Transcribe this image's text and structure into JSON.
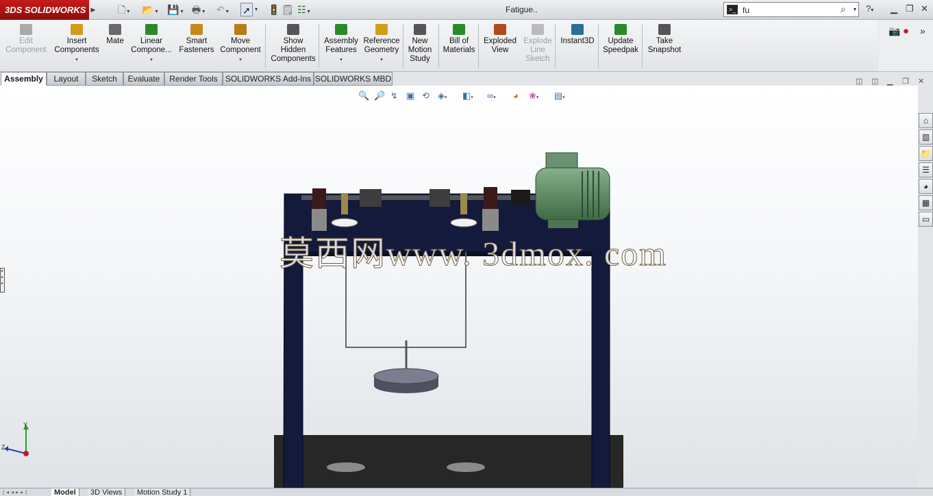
{
  "app": {
    "logo_text": "SOLIDWORKS",
    "logo_mark": "3DS",
    "document_title": "Fatigue.."
  },
  "search": {
    "value": "fu"
  },
  "help_icon": "?",
  "ribbon": {
    "buttons": [
      {
        "label": "Edit\nComponent",
        "icon": "edit-component-icon",
        "disabled": true
      },
      {
        "label": "Insert\nComponents",
        "icon": "insert-components-icon"
      },
      {
        "label": "Mate",
        "icon": "mate-icon"
      },
      {
        "label": "Linear\nCompone...",
        "icon": "linear-pattern-icon"
      },
      {
        "label": "Smart\nFasteners",
        "icon": "smart-fasteners-icon"
      },
      {
        "label": "Move\nComponent",
        "icon": "move-component-icon"
      },
      {
        "label": "Show\nHidden\nComponents",
        "icon": "show-hidden-icon"
      },
      {
        "label": "Assembly\nFeatures",
        "icon": "assembly-features-icon"
      },
      {
        "label": "Reference\nGeometry",
        "icon": "reference-geometry-icon"
      },
      {
        "label": "New\nMotion\nStudy",
        "icon": "motion-study-icon"
      },
      {
        "label": "Bill of\nMaterials",
        "icon": "bom-icon"
      },
      {
        "label": "Exploded\nView",
        "icon": "exploded-view-icon"
      },
      {
        "label": "Explode\nLine\nSketch",
        "icon": "explode-line-icon",
        "disabled": true
      },
      {
        "label": "Instant3D",
        "icon": "instant3d-icon"
      },
      {
        "label": "Update\nSpeedpak",
        "icon": "speedpak-icon"
      },
      {
        "label": "Take\nSnapshot",
        "icon": "snapshot-icon"
      }
    ]
  },
  "tabs": [
    "Assembly",
    "Layout",
    "Sketch",
    "Evaluate",
    "Render Tools",
    "SOLIDWORKS Add-Ins",
    "SOLIDWORKS MBD"
  ],
  "active_tab": "Assembly",
  "watermark": "莫西网www. 3dmox. com",
  "triad": {
    "y": "Y",
    "z": "Z"
  },
  "bottom_tabs": [
    "Model",
    "3D Views",
    "Motion Study 1"
  ],
  "active_bottom_tab": "Model",
  "colors": {
    "accent": "#c71b1b",
    "frame": "#141a3c",
    "motor": "#5e8a63"
  }
}
